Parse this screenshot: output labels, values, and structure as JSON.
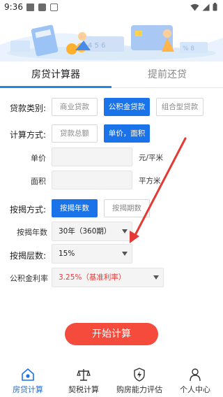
{
  "status_bar": {
    "time": "9:36"
  },
  "tabs": [
    {
      "label": "房贷计算器",
      "active": true
    },
    {
      "label": "提前还贷",
      "active": false
    }
  ],
  "loan_type": {
    "label": "贷款类别:",
    "options": [
      "商业贷款",
      "公积金贷款",
      "组合型贷款"
    ],
    "selected": "公积金贷款"
  },
  "calc_method": {
    "label": "计算方式:",
    "options": [
      "贷款总额",
      "单价，面积"
    ],
    "selected": "单价，面积"
  },
  "unit_price": {
    "label": "单价",
    "value": "",
    "unit": "元/平米"
  },
  "area": {
    "label": "面积",
    "value": "",
    "unit": "平方米"
  },
  "mortgage_method": {
    "label": "按揭方式:",
    "options": [
      "按揭年数",
      "按揭期数"
    ],
    "selected": "按揭年数"
  },
  "mortgage_years": {
    "label": "按揭年数",
    "value": "30年（360期）"
  },
  "mortgage_ratio": {
    "label": "按揭层数:",
    "value": "15%"
  },
  "fund_rate": {
    "label": "公积金利率",
    "value": "3.25%（基准利率）"
  },
  "start_button": "开始计算",
  "bottom_nav": [
    {
      "label": "房贷计算",
      "icon": "house-icon",
      "active": true
    },
    {
      "label": "契税计算",
      "icon": "scale-icon",
      "active": false
    },
    {
      "label": "购房能力评估",
      "icon": "shield-lightning-icon",
      "active": false
    },
    {
      "label": "个人中心",
      "icon": "person-icon",
      "active": false
    }
  ],
  "colors": {
    "accent_blue": "#1a73e8",
    "start_red": "#f44b3c",
    "rate_red": "#e53935",
    "annotation_arrow": "#e53935"
  }
}
